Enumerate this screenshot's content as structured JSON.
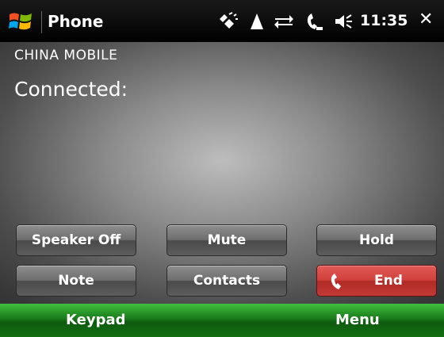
{
  "titlebar": {
    "title": "Phone",
    "time": "11:35",
    "close_glyph": "✕",
    "icons": [
      "start-icon",
      "connectivity-icon",
      "signal-icon",
      "data-sync-icon",
      "call-active-icon",
      "volume-icon"
    ]
  },
  "call": {
    "carrier": "CHINA  MOBILE",
    "status": "Connected:"
  },
  "buttons": {
    "speaker": "Speaker Off",
    "mute": "Mute",
    "hold": "Hold",
    "note": "Note",
    "contacts": "Contacts",
    "end": "End"
  },
  "softkeys": {
    "left": "Keypad",
    "right": "Menu"
  },
  "colors": {
    "end_button": "#d0413c",
    "softkey_bar": "#1a7a1a"
  }
}
